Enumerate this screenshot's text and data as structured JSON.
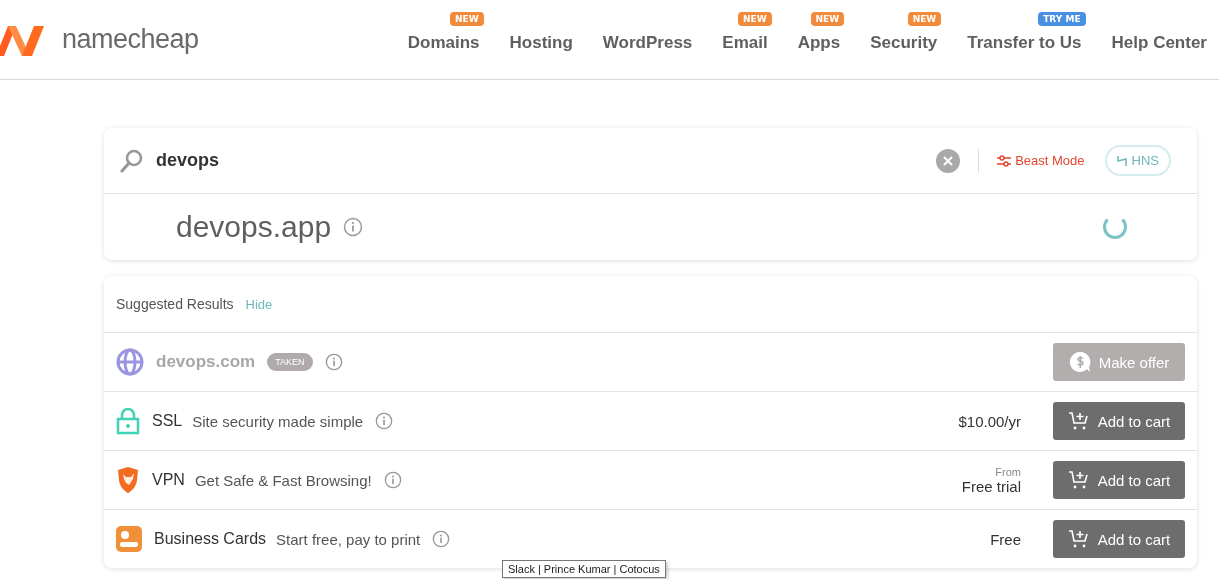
{
  "logo": {
    "text": "namecheap"
  },
  "nav": [
    {
      "label": "Domains",
      "badge": "NEW",
      "color": "#f28a3c"
    },
    {
      "label": "Hosting"
    },
    {
      "label": "WordPress"
    },
    {
      "label": "Email",
      "badge": "NEW",
      "color": "#f28a3c"
    },
    {
      "label": "Apps",
      "badge": "NEW",
      "color": "#f28a3c"
    },
    {
      "label": "Security",
      "badge": "NEW",
      "color": "#f28a3c"
    },
    {
      "label": "Transfer to Us",
      "badge": "TRY ME",
      "color": "#4a90e2"
    },
    {
      "label": "Help Center"
    }
  ],
  "search": {
    "value": "devops",
    "beast_mode": "Beast Mode",
    "hns": "HNS",
    "result": "devops.app"
  },
  "suggested": {
    "title": "Suggested Results",
    "hide": "Hide",
    "rows": [
      {
        "kind": "domain",
        "name": "devops.com",
        "badge": "TAKEN",
        "button": "Make offer",
        "disabled": true
      },
      {
        "kind": "ssl",
        "name": "SSL",
        "description": "Site security made simple",
        "price": "$10.00/yr",
        "button": "Add to cart",
        "disabled": false
      },
      {
        "kind": "vpn",
        "name": "VPN",
        "description": "Get Safe & Fast Browsing!",
        "price_prefix": "From",
        "price": "Free trial",
        "button": "Add to cart",
        "disabled": false
      },
      {
        "kind": "cards",
        "name": "Business Cards",
        "description": "Start free, pay to print",
        "price": "Free",
        "button": "Add to cart",
        "disabled": false
      }
    ]
  },
  "tooltip": "Slack | Prince Kumar | Cotocus"
}
